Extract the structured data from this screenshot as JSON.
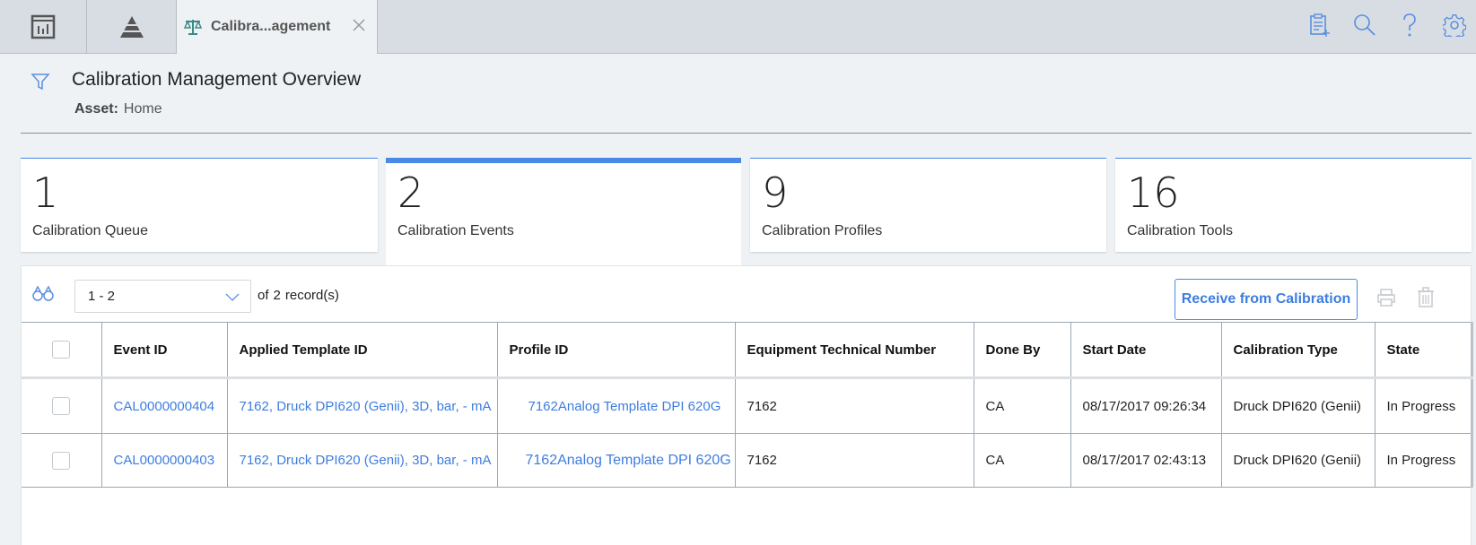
{
  "topbar": {
    "tabs": [
      {
        "icon": "dashboard-icon"
      },
      {
        "icon": "pyramid-icon"
      },
      {
        "icon": "scales-icon",
        "label": "Calibra...agement",
        "active": true
      }
    ],
    "actions": [
      "new-document-icon",
      "search-icon",
      "help-icon",
      "gear-icon"
    ]
  },
  "header": {
    "title": "Calibration Management Overview",
    "asset_label": "Asset:",
    "asset_value": "Home"
  },
  "cards": [
    {
      "count": "1",
      "label": "Calibration Queue"
    },
    {
      "count": "2",
      "label": "Calibration Events",
      "selected": true
    },
    {
      "count": "9",
      "label": "Calibration Profiles"
    },
    {
      "count": "16",
      "label": "Calibration Tools"
    }
  ],
  "toolbar": {
    "range": "1 - 2",
    "of_label": "of",
    "total": "2",
    "records_label": "record(s)",
    "receive_button": "Receive from Calibration"
  },
  "table": {
    "columns": [
      "Event ID",
      "Applied Template ID",
      "Profile ID",
      "Equipment Technical Number",
      "Done By",
      "Start Date",
      "Calibration Type",
      "State"
    ],
    "rows": [
      {
        "event_id": "CAL0000000404",
        "template": "7162, Druck DPI620 (Genii), 3D, bar, - mA",
        "profile": "7162Analog Template DPI 620G",
        "equip": "7162",
        "done_by": "CA",
        "start": "08/17/2017 09:26:34",
        "type": "Druck DPI620 (Genii)",
        "state": "In Progress"
      },
      {
        "event_id": "CAL0000000403",
        "template": "7162, Druck DPI620 (Genii), 3D, bar, - mA",
        "profile": "7162Analog Template DPI 620G",
        "equip": "7162",
        "done_by": "CA",
        "start": "08/17/2017 02:43:13",
        "type": "Druck DPI620 (Genii)",
        "state": "In Progress"
      }
    ]
  },
  "colors": {
    "accent": "#4a8ae6",
    "link": "#3d7de0",
    "tab_icon": "#3a8a86"
  }
}
